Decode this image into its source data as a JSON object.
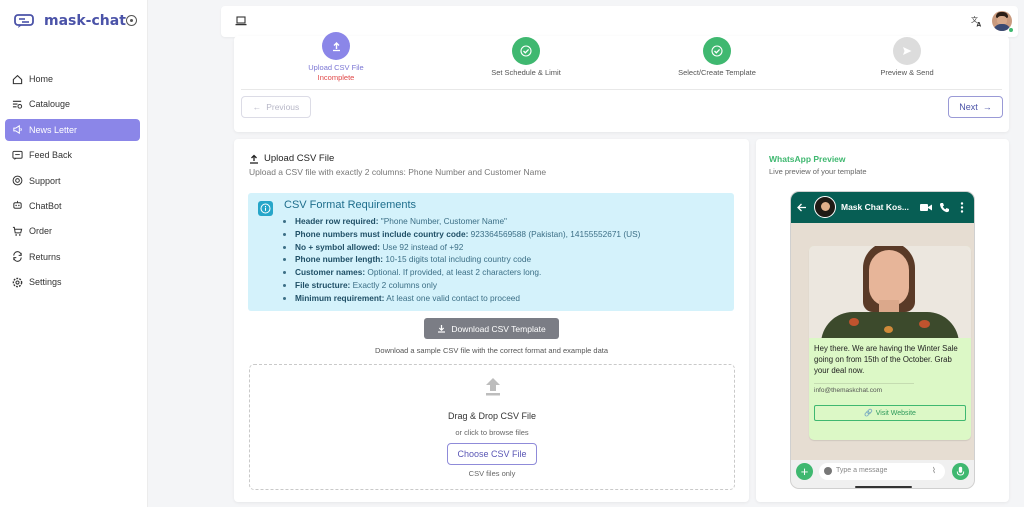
{
  "brand": {
    "name": "mask-chat"
  },
  "nav": [
    {
      "label": "Home",
      "icon": "home-icon"
    },
    {
      "label": "Catalouge",
      "icon": "catalogue-icon"
    },
    {
      "label": "News Letter",
      "icon": "megaphone-icon"
    },
    {
      "label": "Feed Back",
      "icon": "feedback-icon"
    },
    {
      "label": "Support",
      "icon": "support-icon"
    },
    {
      "label": "ChatBot",
      "icon": "chatbot-icon"
    },
    {
      "label": "Order",
      "icon": "cart-icon"
    },
    {
      "label": "Returns",
      "icon": "returns-icon"
    },
    {
      "label": "Settings",
      "icon": "settings-icon"
    }
  ],
  "steps": [
    {
      "label": "Upload CSV File",
      "status": "Incomplete"
    },
    {
      "label": "Set Schedule & Limit"
    },
    {
      "label": "Select/Create Template"
    },
    {
      "label": "Preview & Send"
    }
  ],
  "buttons": {
    "previous": "Previous",
    "next": "Next"
  },
  "upload": {
    "title": "Upload CSV File",
    "subtitle": "Upload a CSV file with exactly 2 columns: Phone Number and Customer Name",
    "req_title": "CSV Format Requirements",
    "requirements": [
      {
        "bold": "Header row required:",
        "text": " \"Phone Number, Customer Name\""
      },
      {
        "bold": "Phone numbers must include country code:",
        "text": " 923364569588 (Pakistan), 14155552671 (US)"
      },
      {
        "bold": "No + symbol allowed:",
        "text": " Use 92 instead of +92"
      },
      {
        "bold": "Phone number length:",
        "text": " 10-15 digits total including country code"
      },
      {
        "bold": "Customer names:",
        "text": " Optional. If provided, at least 2 characters long."
      },
      {
        "bold": "File structure:",
        "text": " Exactly 2 columns only"
      },
      {
        "bold": "Minimum requirement:",
        "text": " At least one valid contact to proceed"
      }
    ],
    "download_label": "Download CSV Template",
    "download_hint": "Download a sample CSV file with the correct format and example data",
    "drop_title": "Drag & Drop CSV File",
    "drop_hint": "or click to browse files",
    "choose_label": "Choose CSV File",
    "files_only": "CSV files only"
  },
  "preview": {
    "title": "WhatsApp Preview",
    "subtitle": "Live preview of your template",
    "contact": "Mask Chat Kos...",
    "message": "Hey there. We are having the Winter Sale going on from 15th of the October. Grab your deal now.",
    "email": "info@themaskchat.com",
    "visit": "Visit Website",
    "input_placeholder": "Type a message"
  },
  "colors": {
    "accent": "#8b86e8",
    "whatsapp": "#075e54",
    "success": "#3fb870",
    "info_bg": "#d4f2fb"
  }
}
